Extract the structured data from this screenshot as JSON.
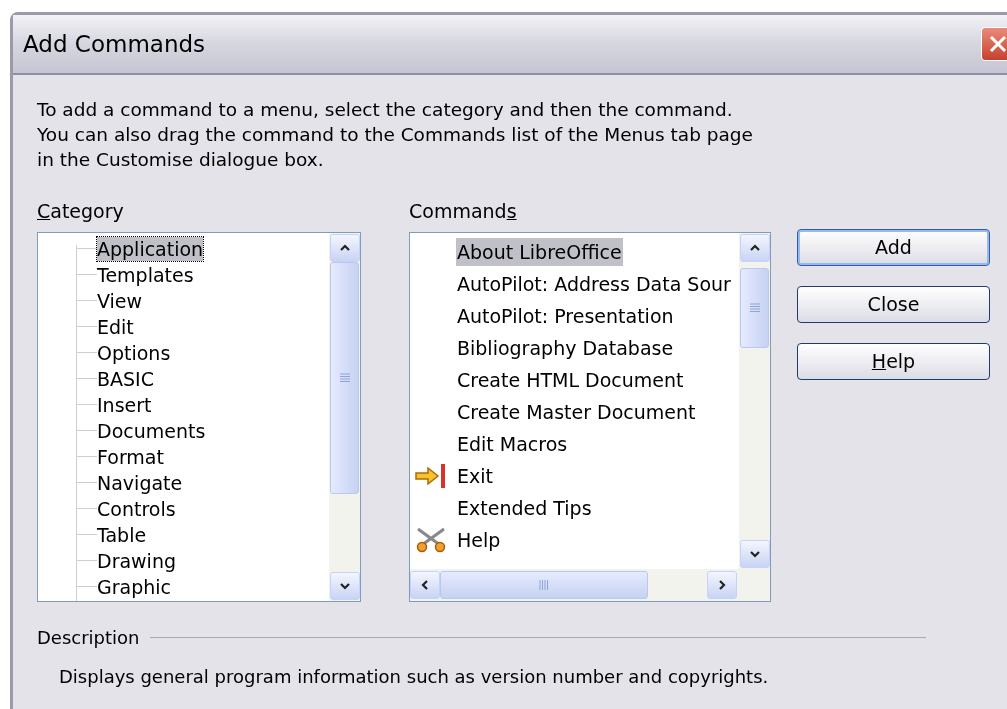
{
  "window": {
    "title": "Add Commands"
  },
  "intro": [
    "To add a command to a menu, select the category and then the command.",
    "You can also drag the command to the Commands list of the Menus tab page",
    "in the Customise dialogue box."
  ],
  "category": {
    "label": {
      "key": "C",
      "after": "ategory"
    },
    "items": [
      {
        "label": "Application",
        "selected": true
      },
      {
        "label": "Templates",
        "selected": false
      },
      {
        "label": "View",
        "selected": false
      },
      {
        "label": "Edit",
        "selected": false
      },
      {
        "label": "Options",
        "selected": false
      },
      {
        "label": "BASIC",
        "selected": false
      },
      {
        "label": "Insert",
        "selected": false
      },
      {
        "label": "Documents",
        "selected": false
      },
      {
        "label": "Format",
        "selected": false
      },
      {
        "label": "Navigate",
        "selected": false
      },
      {
        "label": "Controls",
        "selected": false
      },
      {
        "label": "Table",
        "selected": false
      },
      {
        "label": "Drawing",
        "selected": false
      },
      {
        "label": "Graphic",
        "selected": false
      }
    ]
  },
  "commands": {
    "label": {
      "before": "Command",
      "key": "s"
    },
    "items": [
      {
        "label": "About LibreOffice",
        "selected": true,
        "kind": "plain"
      },
      {
        "label": "AutoPilot: Address Data Sour",
        "selected": false,
        "kind": "plain"
      },
      {
        "label": "AutoPilot: Presentation",
        "selected": false,
        "kind": "plain"
      },
      {
        "label": "Bibliography Database",
        "selected": false,
        "kind": "plain"
      },
      {
        "label": "Create HTML Document",
        "selected": false,
        "kind": "plain"
      },
      {
        "label": "Create Master Document",
        "selected": false,
        "kind": "plain"
      },
      {
        "label": "Edit Macros",
        "selected": false,
        "kind": "plain"
      },
      {
        "label": "Exit",
        "selected": false,
        "kind": "exit"
      },
      {
        "label": "Extended Tips",
        "selected": false,
        "kind": "plain"
      },
      {
        "label": "Help",
        "selected": false,
        "kind": "help"
      }
    ]
  },
  "buttons": [
    {
      "after": "Add",
      "default": true
    },
    {
      "after": "Close",
      "default": false
    },
    {
      "key": "H",
      "after": "elp",
      "default": false
    }
  ],
  "description": {
    "label": "Description",
    "text": "Displays general program information such as version number and copyrights."
  }
}
